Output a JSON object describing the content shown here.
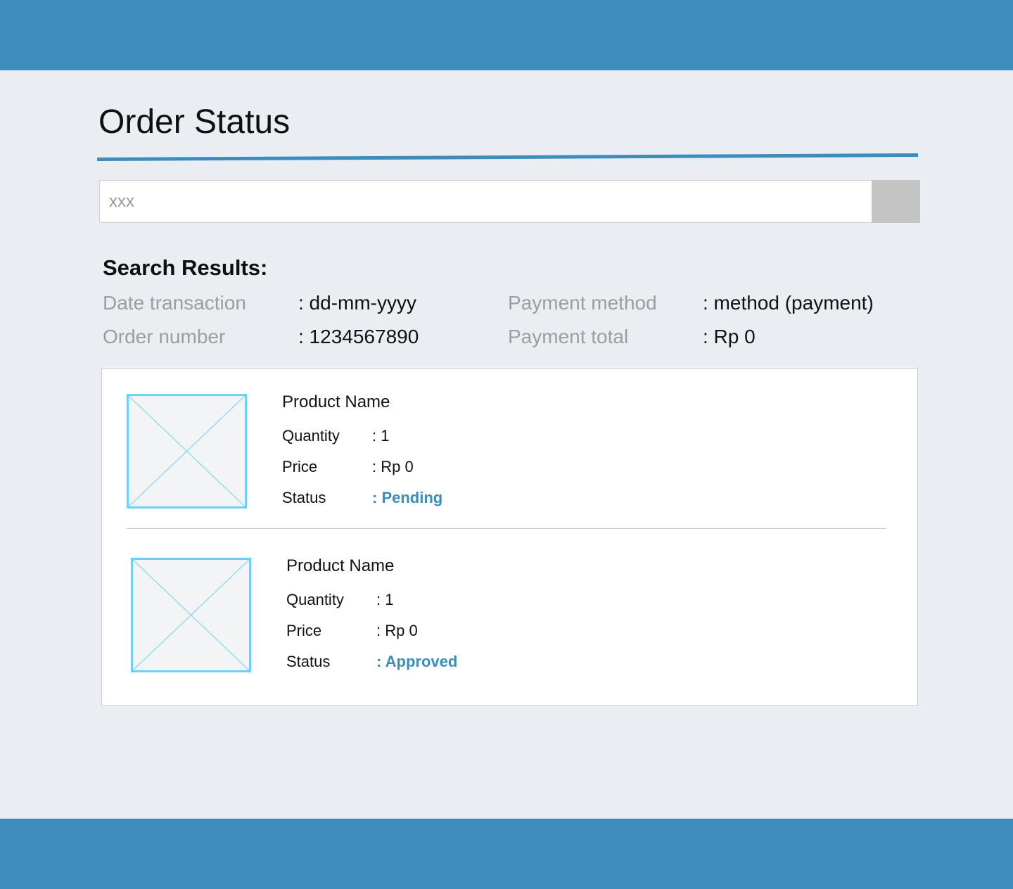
{
  "colors": {
    "accent": "#3c8cbc",
    "background": "#eaeef3",
    "search_button": "#c4c4c4",
    "placeholder_frame": "#6fcff5"
  },
  "page": {
    "title": "Order Status"
  },
  "search": {
    "placeholder": "xxx",
    "value": ""
  },
  "results": {
    "heading": "Search Results:",
    "date_label": "Date transaction",
    "date_value": ": dd-mm-yyyy",
    "order_label": "Order number",
    "order_value": ": 1234567890",
    "method_label": "Payment method",
    "method_value": ": method (payment)",
    "total_label": "Payment total",
    "total_value": ": Rp 0"
  },
  "products": [
    {
      "image_icon": "image-placeholder-icon",
      "name": "Product Name",
      "quantity_label": "Quantity",
      "quantity_value": ": 1",
      "price_label": "Price",
      "price_value": ": Rp 0",
      "status_label": "Status",
      "status_value": ": Pending"
    },
    {
      "image_icon": "image-placeholder-icon",
      "name": "Product Name",
      "quantity_label": "Quantity",
      "quantity_value": ": 1",
      "price_label": "Price",
      "price_value": ": Rp 0",
      "status_label": "Status",
      "status_value": ": Approved"
    }
  ]
}
